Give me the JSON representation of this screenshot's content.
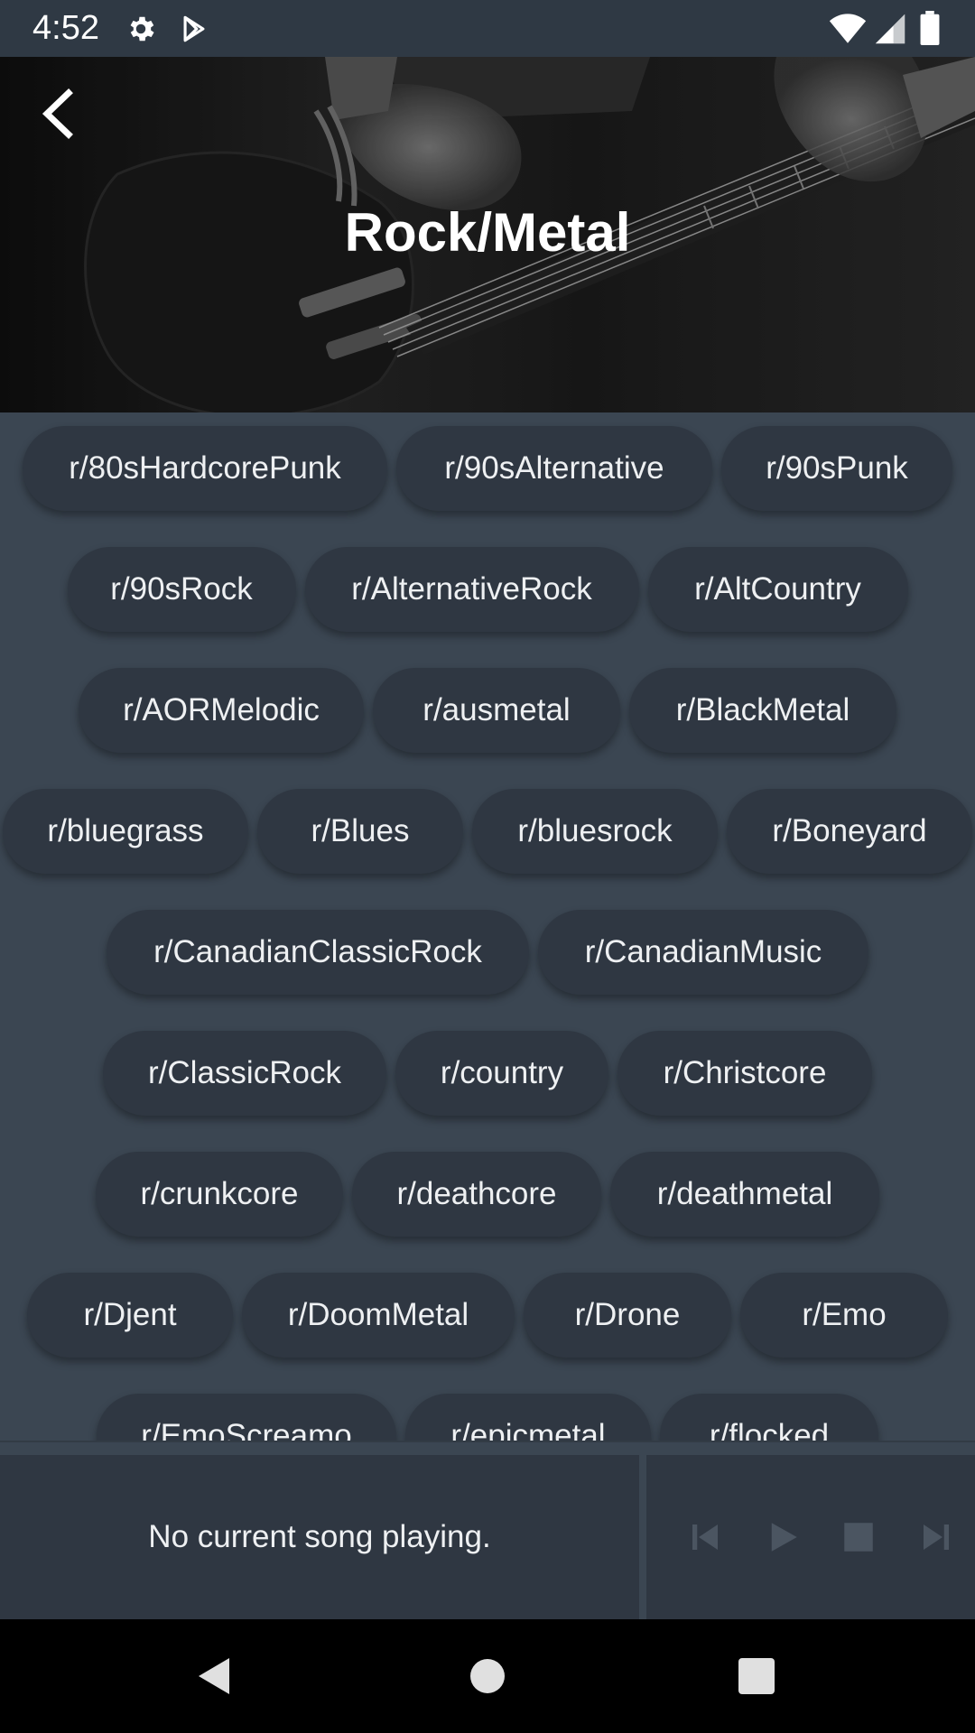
{
  "status_bar": {
    "time": "4:52",
    "icons": [
      "gear-icon",
      "play-store-icon",
      "wifi-icon",
      "signal-icon",
      "battery-icon"
    ]
  },
  "header": {
    "title": "Rock/Metal",
    "back_icon": "chevron-left-icon"
  },
  "chip_rows": [
    [
      "r/80sHardcorePunk",
      "r/90sAlternative",
      "r/90sPunk"
    ],
    [
      "r/90sRock",
      "r/AlternativeRock",
      "r/AltCountry"
    ],
    [
      "r/AORMelodic",
      "r/ausmetal",
      "r/BlackMetal"
    ],
    [
      "r/bluegrass",
      "r/Blues",
      "r/bluesrock",
      "r/Boneyard"
    ],
    [
      "r/CanadianClassicRock",
      "r/CanadianMusic"
    ],
    [
      "r/ClassicRock",
      "r/country",
      "r/Christcore"
    ],
    [
      "r/crunkcore",
      "r/deathcore",
      "r/deathmetal"
    ],
    [
      "r/Djent",
      "r/DoomMetal",
      "r/Drone",
      "r/Emo"
    ],
    [
      "r/EmoScreamo",
      "r/epicmetal",
      "r/flocked"
    ]
  ],
  "player": {
    "now_playing": "No current song playing.",
    "controls": [
      "skip-previous-icon",
      "play-icon",
      "stop-icon",
      "skip-next-icon"
    ]
  },
  "nav_bar": {
    "buttons": [
      "back-triangle-icon",
      "home-circle-icon",
      "recents-square-icon"
    ]
  },
  "colors": {
    "background": "#3b4652",
    "chip": "#2f3742",
    "text": "#eef0f2",
    "status_bar": "#2f3944",
    "control_disabled": "#4b5561"
  }
}
